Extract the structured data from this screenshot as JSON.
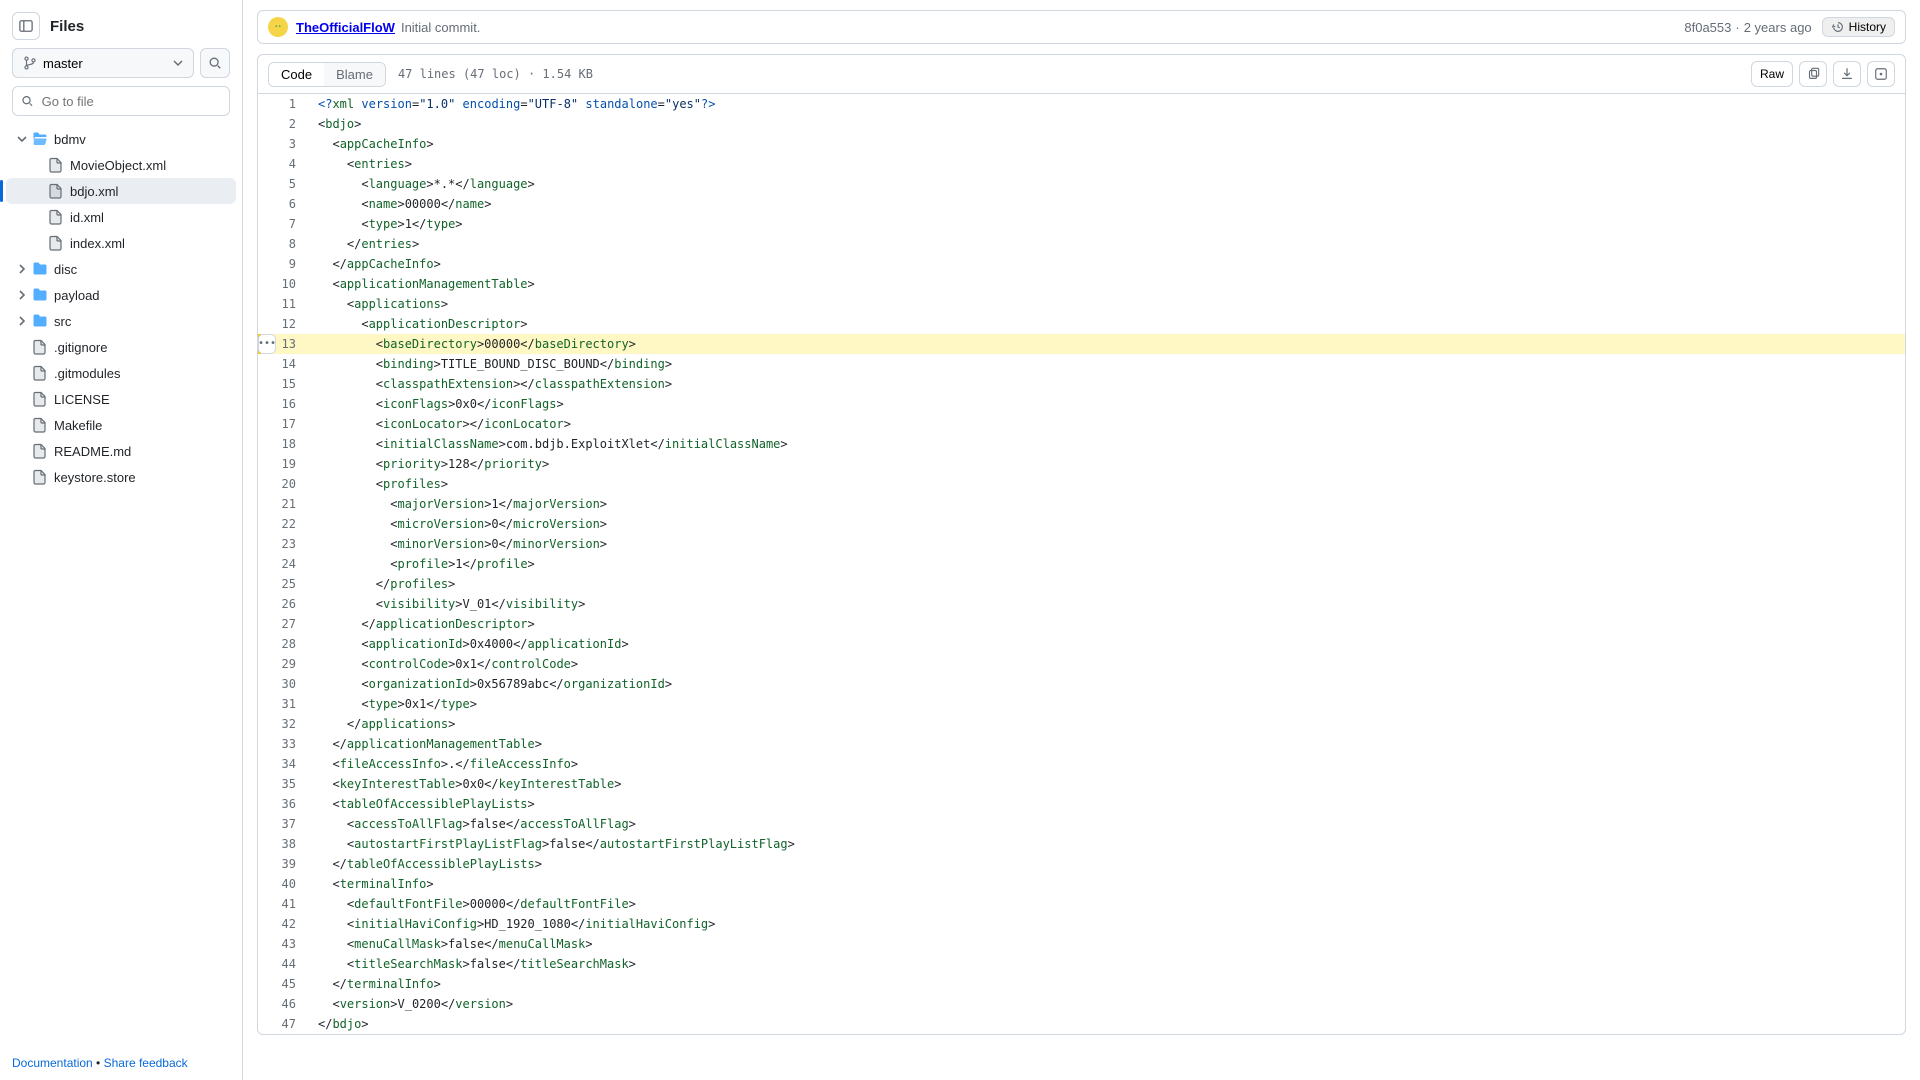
{
  "sidebar": {
    "title": "Files",
    "branch": "master",
    "search_placeholder": "Go to file",
    "footer": {
      "doc": "Documentation",
      "sep": " • ",
      "feedback": "Share feedback"
    }
  },
  "tree": [
    {
      "kind": "folder",
      "name": "bdmv",
      "depth": 0,
      "open": true
    },
    {
      "kind": "file",
      "name": "MovieObject.xml",
      "depth": 1
    },
    {
      "kind": "file",
      "name": "bdjo.xml",
      "depth": 1,
      "selected": true
    },
    {
      "kind": "file",
      "name": "id.xml",
      "depth": 1
    },
    {
      "kind": "file",
      "name": "index.xml",
      "depth": 1
    },
    {
      "kind": "folder",
      "name": "disc",
      "depth": 0,
      "open": false
    },
    {
      "kind": "folder",
      "name": "payload",
      "depth": 0,
      "open": false
    },
    {
      "kind": "folder",
      "name": "src",
      "depth": 0,
      "open": false
    },
    {
      "kind": "file",
      "name": ".gitignore",
      "depth": 0
    },
    {
      "kind": "file",
      "name": ".gitmodules",
      "depth": 0
    },
    {
      "kind": "file",
      "name": "LICENSE",
      "depth": 0
    },
    {
      "kind": "file",
      "name": "Makefile",
      "depth": 0
    },
    {
      "kind": "file",
      "name": "README.md",
      "depth": 0
    },
    {
      "kind": "file",
      "name": "keystore.store",
      "depth": 0
    }
  ],
  "header": {
    "author": "TheOfficialFloW",
    "message": "Initial commit.",
    "sha": "8f0a553",
    "age": "2 years ago",
    "history": "History"
  },
  "toolbar": {
    "code": "Code",
    "blame": "Blame",
    "meta": "47 lines (47 loc) · 1.54 KB",
    "raw": "Raw"
  },
  "highlight_line": 13,
  "hover_line": 13,
  "source": [
    [
      {
        "c": "t-pi",
        "t": "<?"
      },
      {
        "c": "t-tag",
        "t": "xml"
      },
      {
        "t": " "
      },
      {
        "c": "t-attr",
        "t": "version"
      },
      {
        "t": "="
      },
      {
        "c": "t-str",
        "t": "\"1.0\""
      },
      {
        "t": " "
      },
      {
        "c": "t-attr",
        "t": "encoding"
      },
      {
        "t": "="
      },
      {
        "c": "t-str",
        "t": "\"UTF-8\""
      },
      {
        "t": " "
      },
      {
        "c": "t-attr",
        "t": "standalone"
      },
      {
        "t": "="
      },
      {
        "c": "t-str",
        "t": "\"yes\""
      },
      {
        "c": "t-pi",
        "t": "?>"
      }
    ],
    [
      {
        "t": "<"
      },
      {
        "c": "t-tag",
        "t": "bdjo"
      },
      {
        "t": ">"
      }
    ],
    [
      {
        "t": "  <"
      },
      {
        "c": "t-tag",
        "t": "appCacheInfo"
      },
      {
        "t": ">"
      }
    ],
    [
      {
        "t": "    <"
      },
      {
        "c": "t-tag",
        "t": "entries"
      },
      {
        "t": ">"
      }
    ],
    [
      {
        "t": "      <"
      },
      {
        "c": "t-tag",
        "t": "language"
      },
      {
        "t": ">*.*</"
      },
      {
        "c": "t-tag",
        "t": "language"
      },
      {
        "t": ">"
      }
    ],
    [
      {
        "t": "      <"
      },
      {
        "c": "t-tag",
        "t": "name"
      },
      {
        "t": ">00000</"
      },
      {
        "c": "t-tag",
        "t": "name"
      },
      {
        "t": ">"
      }
    ],
    [
      {
        "t": "      <"
      },
      {
        "c": "t-tag",
        "t": "type"
      },
      {
        "t": ">1</"
      },
      {
        "c": "t-tag",
        "t": "type"
      },
      {
        "t": ">"
      }
    ],
    [
      {
        "t": "    </"
      },
      {
        "c": "t-tag",
        "t": "entries"
      },
      {
        "t": ">"
      }
    ],
    [
      {
        "t": "  </"
      },
      {
        "c": "t-tag",
        "t": "appCacheInfo"
      },
      {
        "t": ">"
      }
    ],
    [
      {
        "t": "  <"
      },
      {
        "c": "t-tag",
        "t": "applicationManagementTable"
      },
      {
        "t": ">"
      }
    ],
    [
      {
        "t": "    <"
      },
      {
        "c": "t-tag",
        "t": "applications"
      },
      {
        "t": ">"
      }
    ],
    [
      {
        "t": "      <"
      },
      {
        "c": "t-tag",
        "t": "applicationDescriptor"
      },
      {
        "t": ">"
      }
    ],
    [
      {
        "t": "        <"
      },
      {
        "c": "t-tag",
        "t": "baseDirectory"
      },
      {
        "t": ">00000</"
      },
      {
        "c": "t-tag",
        "t": "baseDirectory"
      },
      {
        "t": ">"
      }
    ],
    [
      {
        "t": "        <"
      },
      {
        "c": "t-tag",
        "t": "binding"
      },
      {
        "t": ">TITLE_BOUND_DISC_BOUND</"
      },
      {
        "c": "t-tag",
        "t": "binding"
      },
      {
        "t": ">"
      }
    ],
    [
      {
        "t": "        <"
      },
      {
        "c": "t-tag",
        "t": "classpathExtension"
      },
      {
        "t": "></"
      },
      {
        "c": "t-tag",
        "t": "classpathExtension"
      },
      {
        "t": ">"
      }
    ],
    [
      {
        "t": "        <"
      },
      {
        "c": "t-tag",
        "t": "iconFlags"
      },
      {
        "t": ">0x0</"
      },
      {
        "c": "t-tag",
        "t": "iconFlags"
      },
      {
        "t": ">"
      }
    ],
    [
      {
        "t": "        <"
      },
      {
        "c": "t-tag",
        "t": "iconLocator"
      },
      {
        "t": "></"
      },
      {
        "c": "t-tag",
        "t": "iconLocator"
      },
      {
        "t": ">"
      }
    ],
    [
      {
        "t": "        <"
      },
      {
        "c": "t-tag",
        "t": "initialClassName"
      },
      {
        "t": ">com.bdjb.ExploitXlet</"
      },
      {
        "c": "t-tag",
        "t": "initialClassName"
      },
      {
        "t": ">"
      }
    ],
    [
      {
        "t": "        <"
      },
      {
        "c": "t-tag",
        "t": "priority"
      },
      {
        "t": ">128</"
      },
      {
        "c": "t-tag",
        "t": "priority"
      },
      {
        "t": ">"
      }
    ],
    [
      {
        "t": "        <"
      },
      {
        "c": "t-tag",
        "t": "profiles"
      },
      {
        "t": ">"
      }
    ],
    [
      {
        "t": "          <"
      },
      {
        "c": "t-tag",
        "t": "majorVersion"
      },
      {
        "t": ">1</"
      },
      {
        "c": "t-tag",
        "t": "majorVersion"
      },
      {
        "t": ">"
      }
    ],
    [
      {
        "t": "          <"
      },
      {
        "c": "t-tag",
        "t": "microVersion"
      },
      {
        "t": ">0</"
      },
      {
        "c": "t-tag",
        "t": "microVersion"
      },
      {
        "t": ">"
      }
    ],
    [
      {
        "t": "          <"
      },
      {
        "c": "t-tag",
        "t": "minorVersion"
      },
      {
        "t": ">0</"
      },
      {
        "c": "t-tag",
        "t": "minorVersion"
      },
      {
        "t": ">"
      }
    ],
    [
      {
        "t": "          <"
      },
      {
        "c": "t-tag",
        "t": "profile"
      },
      {
        "t": ">1</"
      },
      {
        "c": "t-tag",
        "t": "profile"
      },
      {
        "t": ">"
      }
    ],
    [
      {
        "t": "        </"
      },
      {
        "c": "t-tag",
        "t": "profiles"
      },
      {
        "t": ">"
      }
    ],
    [
      {
        "t": "        <"
      },
      {
        "c": "t-tag",
        "t": "visibility"
      },
      {
        "t": ">V_01</"
      },
      {
        "c": "t-tag",
        "t": "visibility"
      },
      {
        "t": ">"
      }
    ],
    [
      {
        "t": "      </"
      },
      {
        "c": "t-tag",
        "t": "applicationDescriptor"
      },
      {
        "t": ">"
      }
    ],
    [
      {
        "t": "      <"
      },
      {
        "c": "t-tag",
        "t": "applicationId"
      },
      {
        "t": ">0x4000</"
      },
      {
        "c": "t-tag",
        "t": "applicationId"
      },
      {
        "t": ">"
      }
    ],
    [
      {
        "t": "      <"
      },
      {
        "c": "t-tag",
        "t": "controlCode"
      },
      {
        "t": ">0x1</"
      },
      {
        "c": "t-tag",
        "t": "controlCode"
      },
      {
        "t": ">"
      }
    ],
    [
      {
        "t": "      <"
      },
      {
        "c": "t-tag",
        "t": "organizationId"
      },
      {
        "t": ">0x56789abc</"
      },
      {
        "c": "t-tag",
        "t": "organizationId"
      },
      {
        "t": ">"
      }
    ],
    [
      {
        "t": "      <"
      },
      {
        "c": "t-tag",
        "t": "type"
      },
      {
        "t": ">0x1</"
      },
      {
        "c": "t-tag",
        "t": "type"
      },
      {
        "t": ">"
      }
    ],
    [
      {
        "t": "    </"
      },
      {
        "c": "t-tag",
        "t": "applications"
      },
      {
        "t": ">"
      }
    ],
    [
      {
        "t": "  </"
      },
      {
        "c": "t-tag",
        "t": "applicationManagementTable"
      },
      {
        "t": ">"
      }
    ],
    [
      {
        "t": "  <"
      },
      {
        "c": "t-tag",
        "t": "fileAccessInfo"
      },
      {
        "t": ">.</"
      },
      {
        "c": "t-tag",
        "t": "fileAccessInfo"
      },
      {
        "t": ">"
      }
    ],
    [
      {
        "t": "  <"
      },
      {
        "c": "t-tag",
        "t": "keyInterestTable"
      },
      {
        "t": ">0x0</"
      },
      {
        "c": "t-tag",
        "t": "keyInterestTable"
      },
      {
        "t": ">"
      }
    ],
    [
      {
        "t": "  <"
      },
      {
        "c": "t-tag",
        "t": "tableOfAccessiblePlayLists"
      },
      {
        "t": ">"
      }
    ],
    [
      {
        "t": "    <"
      },
      {
        "c": "t-tag",
        "t": "accessToAllFlag"
      },
      {
        "t": ">false</"
      },
      {
        "c": "t-tag",
        "t": "accessToAllFlag"
      },
      {
        "t": ">"
      }
    ],
    [
      {
        "t": "    <"
      },
      {
        "c": "t-tag",
        "t": "autostartFirstPlayListFlag"
      },
      {
        "t": ">false</"
      },
      {
        "c": "t-tag",
        "t": "autostartFirstPlayListFlag"
      },
      {
        "t": ">"
      }
    ],
    [
      {
        "t": "  </"
      },
      {
        "c": "t-tag",
        "t": "tableOfAccessiblePlayLists"
      },
      {
        "t": ">"
      }
    ],
    [
      {
        "t": "  <"
      },
      {
        "c": "t-tag",
        "t": "terminalInfo"
      },
      {
        "t": ">"
      }
    ],
    [
      {
        "t": "    <"
      },
      {
        "c": "t-tag",
        "t": "defaultFontFile"
      },
      {
        "t": ">00000</"
      },
      {
        "c": "t-tag",
        "t": "defaultFontFile"
      },
      {
        "t": ">"
      }
    ],
    [
      {
        "t": "    <"
      },
      {
        "c": "t-tag",
        "t": "initialHaviConfig"
      },
      {
        "t": ">HD_1920_1080</"
      },
      {
        "c": "t-tag",
        "t": "initialHaviConfig"
      },
      {
        "t": ">"
      }
    ],
    [
      {
        "t": "    <"
      },
      {
        "c": "t-tag",
        "t": "menuCallMask"
      },
      {
        "t": ">false</"
      },
      {
        "c": "t-tag",
        "t": "menuCallMask"
      },
      {
        "t": ">"
      }
    ],
    [
      {
        "t": "    <"
      },
      {
        "c": "t-tag",
        "t": "titleSearchMask"
      },
      {
        "t": ">false</"
      },
      {
        "c": "t-tag",
        "t": "titleSearchMask"
      },
      {
        "t": ">"
      }
    ],
    [
      {
        "t": "  </"
      },
      {
        "c": "t-tag",
        "t": "terminalInfo"
      },
      {
        "t": ">"
      }
    ],
    [
      {
        "t": "  <"
      },
      {
        "c": "t-tag",
        "t": "version"
      },
      {
        "t": ">V_0200</"
      },
      {
        "c": "t-tag",
        "t": "version"
      },
      {
        "t": ">"
      }
    ],
    [
      {
        "t": "</"
      },
      {
        "c": "t-tag",
        "t": "bdjo"
      },
      {
        "t": ">"
      }
    ]
  ]
}
